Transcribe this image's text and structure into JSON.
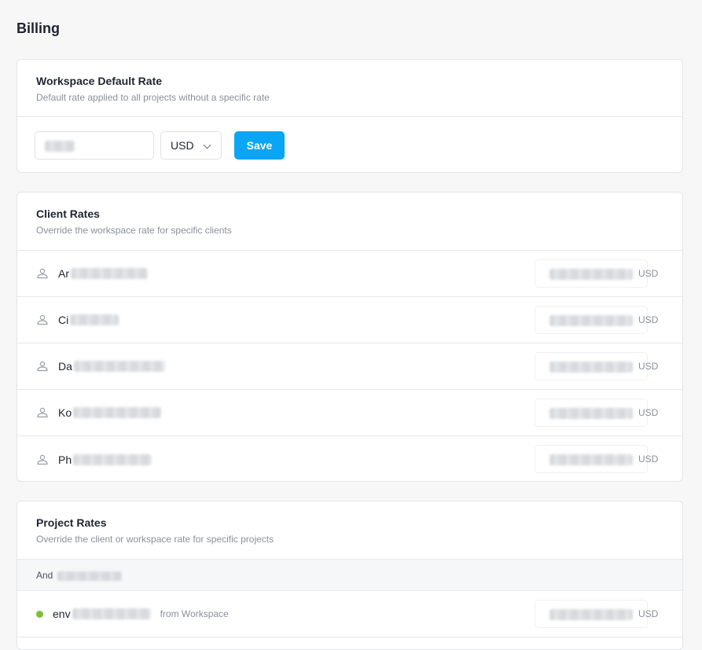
{
  "page": {
    "title": "Billing"
  },
  "workspace_default": {
    "title": "Workspace Default Rate",
    "subtitle": "Default rate applied to all projects without a specific rate",
    "currency": "USD",
    "save_label": "Save"
  },
  "client_rates": {
    "title": "Client Rates",
    "subtitle": "Override the workspace rate for specific clients",
    "rows": [
      {
        "name": "Ar",
        "currency": "USD"
      },
      {
        "name": "Ci",
        "currency": "USD"
      },
      {
        "name": "Da",
        "currency": "USD"
      },
      {
        "name": "Ko",
        "currency": "USD"
      },
      {
        "name": "Ph",
        "currency": "USD"
      }
    ]
  },
  "project_rates": {
    "title": "Project Rates",
    "subtitle": "Override the client or workspace rate for specific projects",
    "groups": [
      {
        "client": "And",
        "projects": [
          {
            "name": "env",
            "source": "from Workspace",
            "currency": "USD",
            "status_color": "#7cbf3a"
          }
        ]
      }
    ]
  },
  "colors": {
    "accent": "#0aa5f5",
    "status_active": "#7cbf3a"
  }
}
